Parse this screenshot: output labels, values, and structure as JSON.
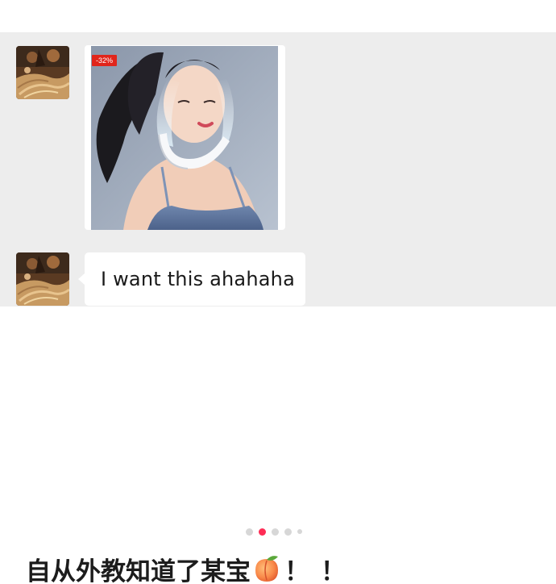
{
  "chat": {
    "messages": [
      {
        "type": "image",
        "sender_avatar": "avatar-icon",
        "badge": "-32%"
      },
      {
        "type": "text",
        "sender_avatar": "avatar-icon",
        "text": "I want this ahahaha"
      }
    ],
    "background_color": "#ededed",
    "bubble_color": "#ffffff"
  },
  "carousel": {
    "total": 5,
    "active_index": 1,
    "active_color": "#fe2c55"
  },
  "post": {
    "caption": "自从外教知道了某宝",
    "emoji": "peach-icon",
    "exclaim": "！！"
  }
}
